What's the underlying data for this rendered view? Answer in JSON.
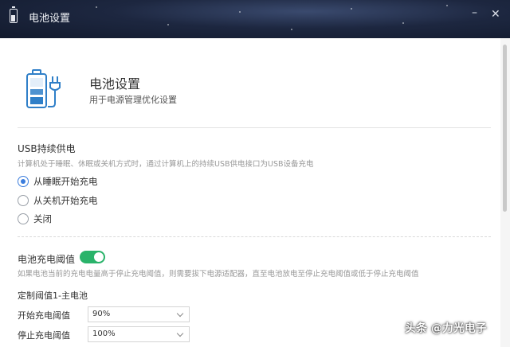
{
  "window": {
    "title": "电池设置",
    "minimize_glyph": "–",
    "close_glyph": "✕"
  },
  "header": {
    "title": "电池设置",
    "subtitle": "用于电源管理优化设置",
    "icon": "battery-plug-icon"
  },
  "usb_section": {
    "title": "USB持续供电",
    "description": "计算机处于睡眠、休眠或关机方式时，通过计算机上的持续USB供电接口为USB设备充电",
    "options": [
      {
        "label": "从睡眠开始充电",
        "checked": true
      },
      {
        "label": "从关机开始充电",
        "checked": false
      },
      {
        "label": "关闭",
        "checked": false
      }
    ]
  },
  "threshold_section": {
    "title": "电池充电阈值",
    "toggle_on": true,
    "description": "如果电池当前的充电电量高于停止充电阈值，则需要拔下电源适配器，直至电池放电至停止充电阈值或低于停止充电阈值",
    "custom_title": "定制阈值1-主电池",
    "start_label": "开始充电阈值",
    "start_value": "90%",
    "stop_label": "停止充电阈值",
    "stop_value": "100%"
  },
  "watermark": "头条 @力光电子",
  "colors": {
    "accent": "#3b7ddd",
    "toggle_on": "#2ab36a",
    "battery_icon": "#2f7fc8",
    "titlebar": "#1d2740"
  }
}
